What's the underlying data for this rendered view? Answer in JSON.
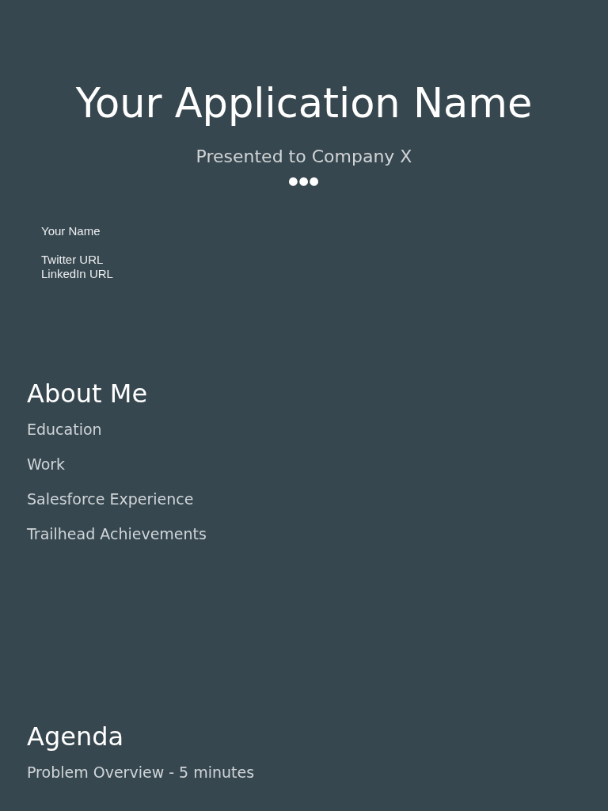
{
  "title_slide": {
    "title": "Your Application Name",
    "subtitle": "Presented to Company X",
    "dots": "●●●",
    "name": "Your Name",
    "links": [
      "Twitter URL",
      "LinkedIn URL"
    ]
  },
  "sections": [
    {
      "heading": "About Me",
      "items": [
        "Education",
        "Work",
        "Salesforce Experience",
        "Trailhead Achievements"
      ]
    },
    {
      "heading": "Agenda",
      "items": [
        "Problem Overview - 5 minutes"
      ]
    }
  ]
}
